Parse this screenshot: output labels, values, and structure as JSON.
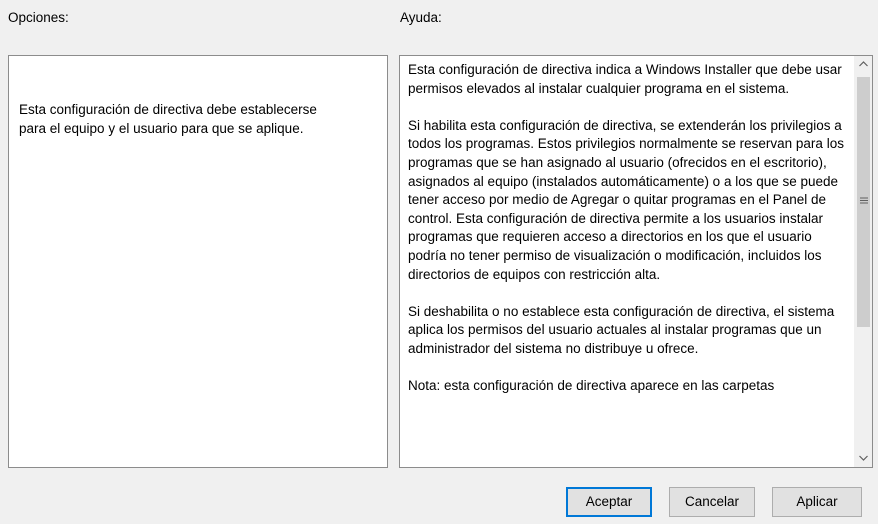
{
  "options": {
    "label": "Opciones:",
    "text": "Esta configuración de directiva debe establecerse\npara el equipo y el usuario para que se aplique."
  },
  "help": {
    "label": "Ayuda:",
    "text": "Esta configuración de directiva indica a Windows Installer que debe usar permisos elevados al instalar cualquier programa en el sistema.\n\nSi habilita esta configuración de directiva, se extenderán los privilegios a todos los programas. Estos privilegios normalmente se reservan para los programas que se han asignado al usuario (ofrecidos en el escritorio), asignados al equipo (instalados automáticamente) o a los que se puede tener acceso por medio de Agregar o quitar programas en el Panel de control. Esta configuración de directiva permite a los usuarios instalar programas que requieren acceso a directorios en los que el usuario podría no tener permiso de visualización o modificación, incluidos los directorios de equipos con restricción alta.\n\nSi deshabilita o no establece esta configuración de directiva, el sistema aplica los permisos del usuario actuales al instalar programas que un administrador del sistema no distribuye u ofrece.\n\nNota: esta configuración de directiva aparece en las carpetas"
  },
  "scrollbar": {
    "up_icon": "chevron-up-icon",
    "down_icon": "chevron-down-icon",
    "grip_icon": "grip-lines-icon"
  },
  "buttons": {
    "accept": "Aceptar",
    "cancel": "Cancelar",
    "apply": "Aplicar"
  }
}
